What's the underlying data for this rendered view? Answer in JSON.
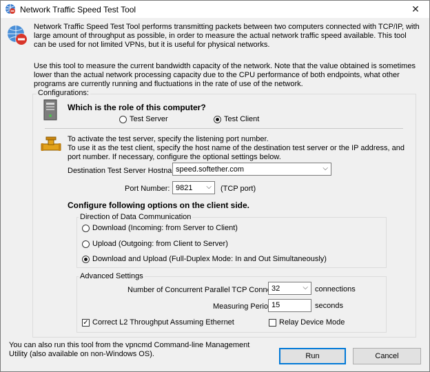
{
  "window": {
    "title": "Network Traffic Speed Test Tool",
    "close_glyph": "✕"
  },
  "intro": {
    "paragraph1": "Network Traffic Speed Test Tool performs transmitting packets between two computers connected with TCP/IP, with large amount of throughput as possible, in order to measure the actual network traffic speed available. This tool can be used for not limited VPNs, but it is useful for physical networks.",
    "paragraph2": "Use this tool to measure the current bandwidth capacity of the network. Note that the value obtained is sometimes lower than the actual network processing capacity due to the CPU performance of both endpoints, what other programs are currently running and fluctuations in the rate of use of the network."
  },
  "configurations": {
    "legend": "Configurations:",
    "role_heading": "Which is the role of this computer?",
    "role_options": [
      {
        "label": "Test Server",
        "selected": false
      },
      {
        "label": "Test Client",
        "selected": true
      }
    ],
    "instructions": "To activate the test server, specify the listening port number.\nTo use it as the test client, specify the host name of the destination test server or the IP address, and port number. If necessary, configure the optional settings below.",
    "hostname_label": "Destination Test Server Hostname:",
    "hostname_value": "speed.softether.com",
    "port_label": "Port Number:",
    "port_value": "9821",
    "port_suffix": "(TCP port)",
    "client_heading": "Configure following options on the client side."
  },
  "direction": {
    "legend": "Direction of Data Communication",
    "options": [
      {
        "label": "Download (Incoming: from Server to Client)",
        "selected": false
      },
      {
        "label": "Upload (Outgoing: from Client to Server)",
        "selected": false
      },
      {
        "label": "Download and Upload (Full-Duplex Mode: In and Out Simultaneously)",
        "selected": true
      }
    ]
  },
  "advanced": {
    "legend": "Advanced Settings",
    "connections_label": "Number of Concurrent Parallel TCP Connections:",
    "connections_value": "32",
    "connections_suffix": "connections",
    "period_label": "Measuring Period:",
    "period_value": "15",
    "period_suffix": "seconds",
    "correct_l2_label": "Correct L2 Throughput Assuming Ethernet",
    "correct_l2_checked": true,
    "relay_label": "Relay Device Mode",
    "relay_checked": false
  },
  "footer": {
    "note": "You can also run this tool from the vpncmd Command-line Management Utility (also available on non-Windows OS).",
    "run_label": "Run",
    "cancel_label": "Cancel"
  },
  "icons": {
    "title_icon": "network-globe-icon",
    "top_icon": "globe-no-entry-icon",
    "computer_icon": "computer-tower-icon",
    "pipe_icon": "pipe-valve-icon"
  }
}
